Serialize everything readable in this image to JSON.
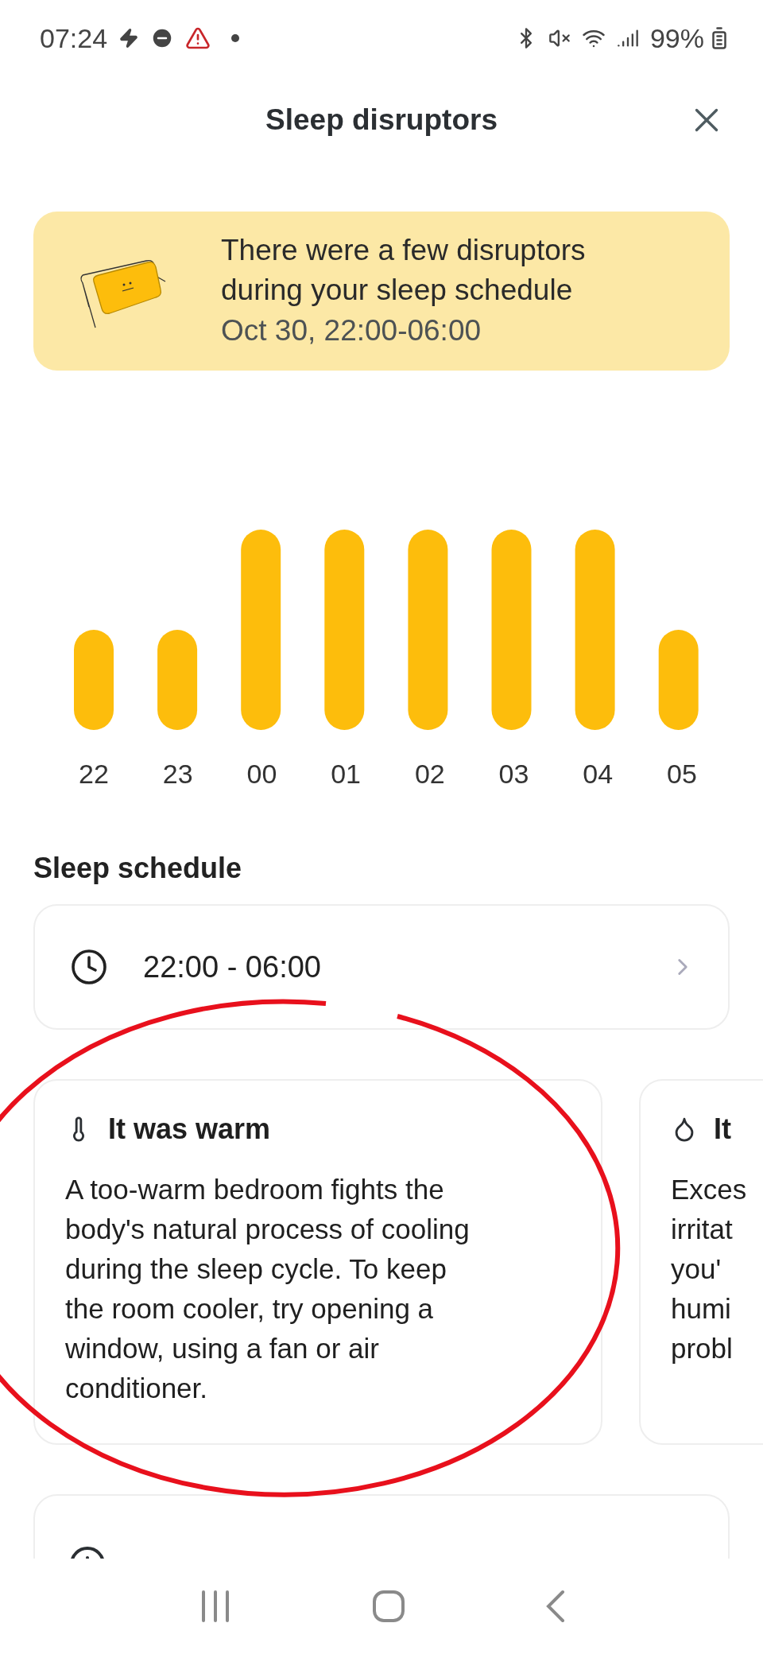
{
  "status_bar": {
    "time": "07:24",
    "battery": "99%"
  },
  "header": {
    "title": "Sleep disruptors"
  },
  "banner": {
    "message": "There were a few disruptors during your sleep schedule",
    "date": "Oct 30, 22:00-06:00"
  },
  "chart": {
    "hour_labels": [
      "22",
      "23",
      "00",
      "01",
      "02",
      "03",
      "04",
      "05"
    ]
  },
  "schedule": {
    "heading": "Sleep schedule",
    "time_range": "22:00 - 06:00"
  },
  "disruptors": [
    {
      "kind": "temperature",
      "title": "It was warm",
      "body_lines": [
        "A too-warm bedroom fights the",
        "body's natural process of cooling",
        "during the sleep cycle. To keep",
        "the room cooler, try opening a",
        "window, using a fan or air",
        "conditioner."
      ]
    },
    {
      "kind": "humidity",
      "title": "It",
      "body_lines": [
        "Exces",
        "irritat",
        "you'",
        "humi",
        "probl"
      ]
    }
  ]
}
